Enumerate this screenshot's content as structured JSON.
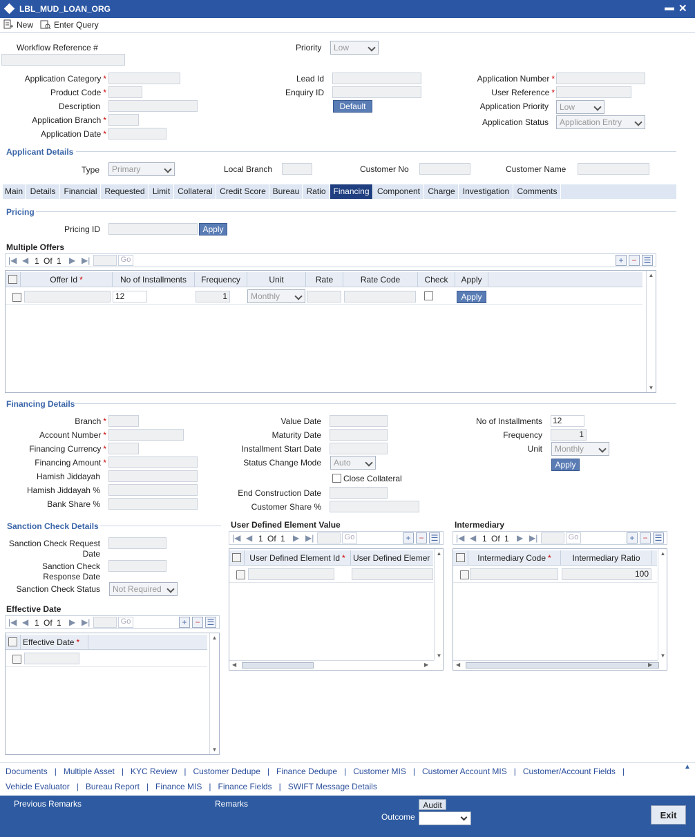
{
  "window": {
    "title": "LBL_MUD_LOAN_ORG",
    "minimize": "▬",
    "close": "✕"
  },
  "toolbar": {
    "new_label": "New",
    "enter_query_label": "Enter Query"
  },
  "header": {
    "workflow_ref_label": "Workflow Reference #",
    "priority_label": "Priority",
    "priority_value": "Low",
    "app_category_label": "Application Category",
    "product_code_label": "Product Code",
    "description_label": "Description",
    "app_branch_label": "Application Branch",
    "app_date_label": "Application Date",
    "lead_id_label": "Lead Id",
    "enquiry_id_label": "Enquiry ID",
    "default_btn": "Default",
    "app_number_label": "Application Number",
    "user_ref_label": "User Reference",
    "app_priority_label": "Application Priority",
    "app_priority_value": "Low",
    "app_status_label": "Application Status",
    "app_status_value": "Application Entry"
  },
  "applicant": {
    "section": "Applicant Details",
    "type_label": "Type",
    "type_value": "Primary",
    "local_branch_label": "Local Branch",
    "customer_no_label": "Customer No",
    "customer_name_label": "Customer Name"
  },
  "tabs": [
    "Main",
    "Details",
    "Financial",
    "Requested",
    "Limit",
    "Collateral",
    "Credit Score",
    "Bureau",
    "Ratio",
    "Financing",
    "Component",
    "Charge",
    "Investigation",
    "Comments"
  ],
  "pricing": {
    "section": "Pricing",
    "pricing_id_label": "Pricing ID",
    "apply_btn": "Apply"
  },
  "multiple_offers": {
    "title": "Multiple Offers",
    "page": "1",
    "of": "Of",
    "total": "1",
    "go": "Go",
    "columns": [
      "Offer Id",
      "No of Installments",
      "Frequency",
      "Unit",
      "Rate",
      "Rate Code",
      "Check",
      "Apply"
    ],
    "row": {
      "installments": "12",
      "frequency": "1",
      "unit": "Monthly",
      "apply": "Apply"
    }
  },
  "financing": {
    "section": "Financing Details",
    "branch_label": "Branch",
    "account_label": "Account Number",
    "currency_label": "Financing Currency",
    "amount_label": "Financing Amount",
    "hamish_label": "Hamish Jiddayah",
    "hamish_pct_label": "Hamish Jiddayah %",
    "bank_share_label": "Bank Share %",
    "value_date_label": "Value Date",
    "maturity_label": "Maturity Date",
    "inst_start_label": "Installment Start Date",
    "status_change_label": "Status Change Mode",
    "status_change_value": "Auto",
    "close_collateral_label": "Close Collateral",
    "end_construction_label": "End Construction Date",
    "customer_share_label": "Customer Share %",
    "no_inst_label": "No of Installments",
    "no_inst_value": "12",
    "frequency_label": "Frequency",
    "frequency_value": "1",
    "unit_label": "Unit",
    "unit_value": "Monthly",
    "apply_btn": "Apply"
  },
  "sanction": {
    "section": "Sanction Check Details",
    "req_date_label_1": "Sanction Check Request",
    "req_date_label_2": "Date",
    "resp_date_label_1": "Sanction Check",
    "resp_date_label_2": "Response Date",
    "status_label": "Sanction Check Status",
    "status_value": "Not Required"
  },
  "effective": {
    "title": "Effective Date",
    "page": "1",
    "of": "Of",
    "total": "1",
    "go": "Go",
    "col": "Effective Date"
  },
  "udf": {
    "title": "User Defined Element Value",
    "page": "1",
    "of": "Of",
    "total": "1",
    "go": "Go",
    "col1": "User Defined Element Id",
    "col2": "User Defined Elemer"
  },
  "intermediary": {
    "title": "Intermediary",
    "page": "1",
    "of": "Of",
    "total": "1",
    "go": "Go",
    "col1": "Intermediary Code",
    "col2": "Intermediary Ratio",
    "ratio_value": "100"
  },
  "footer_links_row1": [
    "Documents",
    "Multiple Asset",
    "KYC Review",
    "Customer Dedupe",
    "Finance Dedupe",
    "Customer MIS",
    "Customer Account MIS",
    "Customer/Account Fields"
  ],
  "footer_links_row2": [
    "Vehicle Evaluator",
    "Bureau Report",
    "Finance MIS",
    "Finance Fields",
    "SWIFT Message Details"
  ],
  "bottom": {
    "prev_remarks": "Previous Remarks",
    "remarks": "Remarks",
    "audit": "Audit",
    "outcome": "Outcome",
    "exit": "Exit"
  }
}
